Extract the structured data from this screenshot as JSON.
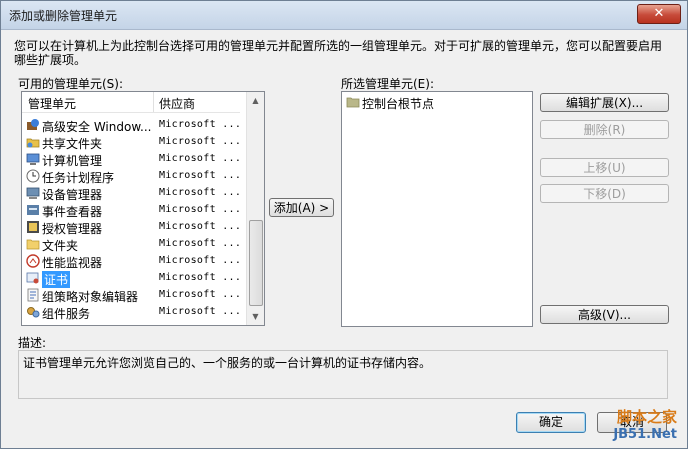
{
  "window": {
    "title": "添加或删除管理单元",
    "close_label": "✕"
  },
  "intro_text": "您可以在计算机上为此控制台选择可用的管理单元并配置所选的一组管理单元。对于可扩展的管理单元，您可以配置要启用哪些扩展项。",
  "available": {
    "label": "可用的管理单元(S):",
    "col_name": "管理单元",
    "col_vendor": "供应商",
    "items": [
      {
        "name": "高级安全 Window...",
        "vendor": "Microsoft ...",
        "icon": "security-icon"
      },
      {
        "name": "共享文件夹",
        "vendor": "Microsoft ...",
        "icon": "shared-folder-icon"
      },
      {
        "name": "计算机管理",
        "vendor": "Microsoft ...",
        "icon": "computer-management-icon"
      },
      {
        "name": "任务计划程序",
        "vendor": "Microsoft ...",
        "icon": "clock-icon"
      },
      {
        "name": "设备管理器",
        "vendor": "Microsoft ...",
        "icon": "device-manager-icon"
      },
      {
        "name": "事件查看器",
        "vendor": "Microsoft ...",
        "icon": "event-viewer-icon"
      },
      {
        "name": "授权管理器",
        "vendor": "Microsoft ...",
        "icon": "authorization-icon"
      },
      {
        "name": "文件夹",
        "vendor": "Microsoft ...",
        "icon": "folder-icon"
      },
      {
        "name": "性能监视器",
        "vendor": "Microsoft ...",
        "icon": "performance-icon"
      },
      {
        "name": "证书",
        "vendor": "Microsoft ...",
        "icon": "certificate-icon",
        "selected": true
      },
      {
        "name": "组策略对象编辑器",
        "vendor": "Microsoft ...",
        "icon": "group-policy-icon"
      },
      {
        "name": "组件服务",
        "vendor": "Microsoft ...",
        "icon": "component-services-icon"
      }
    ]
  },
  "add_button": "添加(A) >",
  "selected": {
    "label": "所选管理单元(E):",
    "items": [
      {
        "name": "控制台根节点",
        "icon": "folder-icon"
      }
    ]
  },
  "side_buttons": {
    "edit_extensions": "编辑扩展(X)...",
    "remove": "删除(R)",
    "move_up": "上移(U)",
    "move_down": "下移(D)",
    "advanced": "高级(V)..."
  },
  "description": {
    "label": "描述:",
    "text": "证书管理单元允许您浏览自己的、一个服务的或一台计算机的证书存储内容。"
  },
  "footer": {
    "ok": "确定",
    "cancel": "取消"
  },
  "watermark": {
    "line1": "脚本之家",
    "line2": "JB51.Net"
  }
}
